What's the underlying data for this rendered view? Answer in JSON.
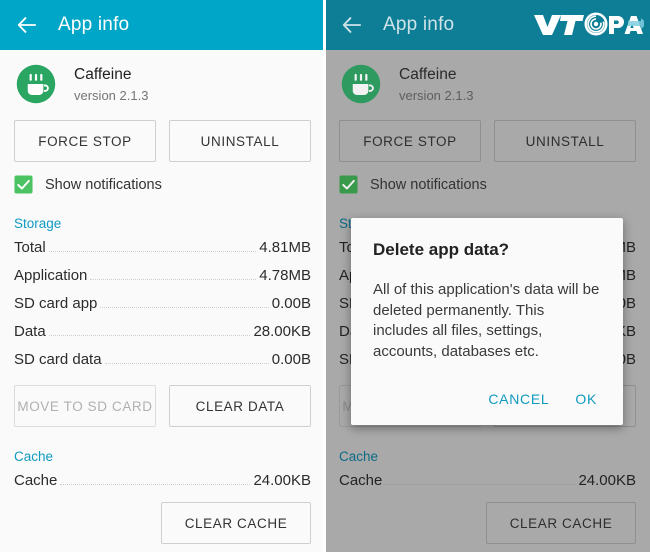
{
  "appbar": {
    "title": "App info",
    "back_icon": "arrow-left-icon",
    "logo_text_primary": "VTC",
    "logo_text_secondary": "Pay",
    "bg_color": "#00a6c8",
    "bg_color_dimmed": "#0d7e96"
  },
  "app": {
    "icon": "coffee-cup-icon",
    "name": "Caffeine",
    "version": "version 2.1.3",
    "icon_color": "#2aa562"
  },
  "actions": {
    "force_stop": "FORCE STOP",
    "uninstall": "UNINSTALL"
  },
  "notifications": {
    "label": "Show notifications",
    "checked": true,
    "check_color": "#4cc362"
  },
  "storage": {
    "heading": "Storage",
    "rows": [
      {
        "key": "Total",
        "value": "4.81MB"
      },
      {
        "key": "Application",
        "value": "4.78MB"
      },
      {
        "key": "SD card app",
        "value": "0.00B"
      },
      {
        "key": "Data",
        "value": "28.00KB"
      },
      {
        "key": "SD card data",
        "value": "0.00B"
      }
    ],
    "move_to_sd": "MOVE TO SD CARD",
    "move_to_sd_disabled": true,
    "clear_data": "CLEAR DATA"
  },
  "cache": {
    "heading": "Cache",
    "rows": [
      {
        "key": "Cache",
        "value": "24.00KB"
      }
    ],
    "clear_cache": "CLEAR CACHE"
  },
  "dialog": {
    "title": "Delete app data?",
    "message": "All of this application's data will be deleted permanently. This includes all files, settings, accounts, databases etc.",
    "cancel": "CANCEL",
    "ok": "OK",
    "accent_color": "#0f9bc0"
  }
}
